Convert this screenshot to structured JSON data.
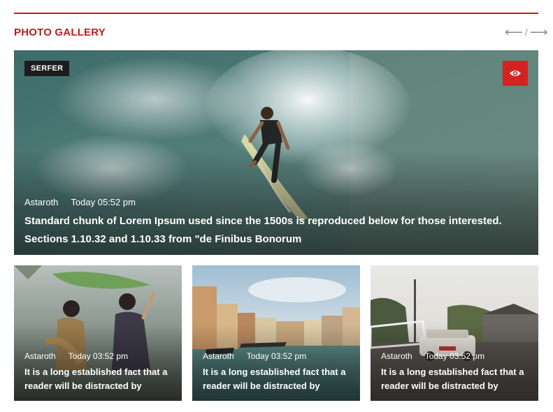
{
  "section": {
    "title": "PHOTO GALLERY",
    "prev_icon": "arrow-left-icon",
    "separator": "/",
    "next_icon": "arrow-right-icon"
  },
  "featured": {
    "category": "SERFER",
    "view_icon": "eye-icon",
    "author": "Astaroth",
    "time": "Today 05:52 pm",
    "title": "Standard chunk of Lorem Ipsum used since the 1500s is reproduced below for those interested. Sections 1.10.32 and 1.10.33 from \"de Finibus Bonorum"
  },
  "cards": [
    {
      "author": "Astaroth",
      "time": "Today 03:52 pm",
      "title": "It is a long established fact that a reader will be distracted by"
    },
    {
      "author": "Astaroth",
      "time": "Today 03:52 pm",
      "title": "It is a long established fact that a reader will be distracted by"
    },
    {
      "author": "Astaroth",
      "time": "Today 03:52 pm",
      "title": "It is a long established fact that a reader will be distracted by"
    }
  ],
  "colors": {
    "accent": "#c41a1a",
    "tag_bg": "#1c1c1c",
    "eye_button": "#d42222"
  }
}
